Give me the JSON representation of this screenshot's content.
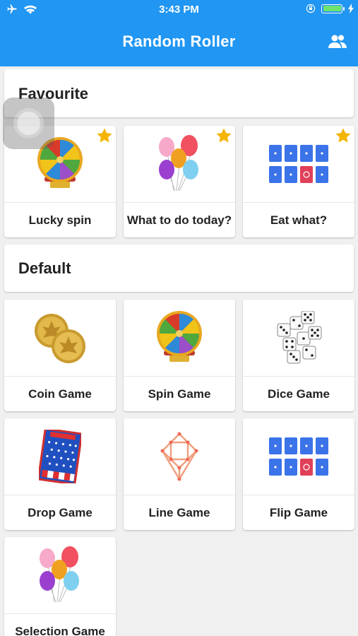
{
  "status_bar": {
    "time": "3:43 PM",
    "icons": [
      "airplane-icon",
      "wifi-icon",
      "orientation-lock-icon",
      "battery-icon",
      "charging-bolt-icon"
    ]
  },
  "app_bar": {
    "title": "Random Roller",
    "action_icon": "people-icon"
  },
  "sections": {
    "favourite": {
      "label": "Favourite",
      "items": [
        {
          "name": "Lucky spin",
          "icon": "spin-wheel-icon",
          "starred": true
        },
        {
          "name": "What to do today?",
          "icon": "balloons-icon",
          "starred": true
        },
        {
          "name": "Eat what?",
          "icon": "flip-cards-icon",
          "starred": true
        }
      ]
    },
    "default": {
      "label": "Default",
      "items": [
        {
          "name": "Coin Game",
          "icon": "coins-icon"
        },
        {
          "name": "Spin Game",
          "icon": "spin-wheel-icon"
        },
        {
          "name": "Dice Game",
          "icon": "dice-icon"
        },
        {
          "name": "Drop Game",
          "icon": "plinko-board-icon"
        },
        {
          "name": "Line Game",
          "icon": "line-graph-icon"
        },
        {
          "name": "Flip Game",
          "icon": "flip-cards-icon"
        },
        {
          "name": "Selection Game",
          "icon": "balloons-icon"
        }
      ]
    }
  },
  "colors": {
    "app_bar": "#2196f3",
    "background": "#f0f0f0",
    "star": "#f5b400",
    "card_tile": "#3b73e8",
    "card_tile_highlight": "#e0405a"
  }
}
